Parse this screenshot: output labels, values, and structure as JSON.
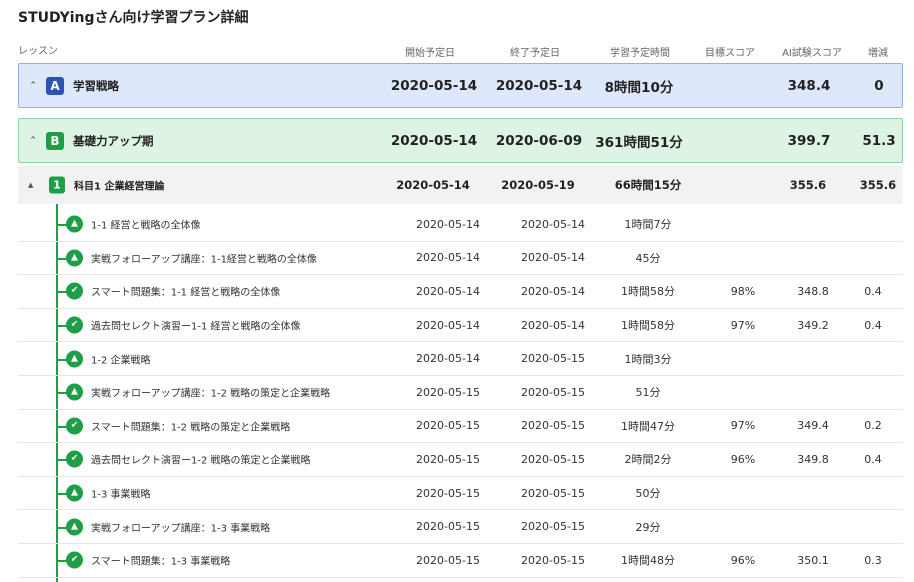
{
  "page": {
    "title": "STUDYingさん向け学習プラン詳細"
  },
  "header": {
    "lesson": "レッスン",
    "start": "開始予定日",
    "end": "終了予定日",
    "time": "学習予定時間",
    "target": "目標スコア",
    "ai_score": "AI試験スコア",
    "delta": "増減"
  },
  "phases": [
    {
      "badge": "A",
      "name": "学習戦略",
      "start": "2020-05-14",
      "end": "2020-05-14",
      "time": "8時間10分",
      "target": "",
      "ai_score": "348.4",
      "delta": "0",
      "expanded": true
    },
    {
      "badge": "B",
      "name": "基礎力アップ期",
      "start": "2020-05-14",
      "end": "2020-06-09",
      "time": "361時間51分",
      "target": "",
      "ai_score": "399.7",
      "delta": "51.3",
      "expanded": true
    }
  ],
  "subject": {
    "badge": "1",
    "name": "科目1 企業経営理論",
    "start": "2020-05-14",
    "end": "2020-05-19",
    "time": "66時間15分",
    "target": "",
    "ai_score": "355.6",
    "delta": "355.6"
  },
  "lessons": [
    {
      "icon": "graduation-cap-icon",
      "name": "1-1 経営と戦略の全体像",
      "start": "2020-05-14",
      "end": "2020-05-14",
      "time": "1時間7分",
      "target": "",
      "ai_score": "",
      "delta": ""
    },
    {
      "icon": "graduation-cap-icon",
      "name": "実戦フォローアップ講座：1-1経営と戦略の全体像",
      "start": "2020-05-14",
      "end": "2020-05-14",
      "time": "45分",
      "target": "",
      "ai_score": "",
      "delta": ""
    },
    {
      "icon": "checklist-icon",
      "name": "スマート問題集：1-1 経営と戦略の全体像",
      "start": "2020-05-14",
      "end": "2020-05-14",
      "time": "1時間58分",
      "target": "98%",
      "ai_score": "348.8",
      "delta": "0.4"
    },
    {
      "icon": "checklist-icon",
      "name": "過去問セレクト演習ー1-1 経営と戦略の全体像",
      "start": "2020-05-14",
      "end": "2020-05-14",
      "time": "1時間58分",
      "target": "97%",
      "ai_score": "349.2",
      "delta": "0.4"
    },
    {
      "icon": "graduation-cap-icon",
      "name": "1-2 企業戦略",
      "start": "2020-05-14",
      "end": "2020-05-15",
      "time": "1時間3分",
      "target": "",
      "ai_score": "",
      "delta": ""
    },
    {
      "icon": "graduation-cap-icon",
      "name": "実戦フォローアップ講座：1-2 戦略の策定と企業戦略",
      "start": "2020-05-15",
      "end": "2020-05-15",
      "time": "51分",
      "target": "",
      "ai_score": "",
      "delta": ""
    },
    {
      "icon": "checklist-icon",
      "name": "スマート問題集：1-2 戦略の策定と企業戦略",
      "start": "2020-05-15",
      "end": "2020-05-15",
      "time": "1時間47分",
      "target": "97%",
      "ai_score": "349.4",
      "delta": "0.2"
    },
    {
      "icon": "checklist-icon",
      "name": "過去問セレクト演習ー1-2 戦略の策定と企業戦略",
      "start": "2020-05-15",
      "end": "2020-05-15",
      "time": "2時間2分",
      "target": "96%",
      "ai_score": "349.8",
      "delta": "0.4"
    },
    {
      "icon": "graduation-cap-icon",
      "name": "1-3 事業戦略",
      "start": "2020-05-15",
      "end": "2020-05-15",
      "time": "50分",
      "target": "",
      "ai_score": "",
      "delta": ""
    },
    {
      "icon": "graduation-cap-icon",
      "name": "実戦フォローアップ講座：1-3 事業戦略",
      "start": "2020-05-15",
      "end": "2020-05-15",
      "time": "29分",
      "target": "",
      "ai_score": "",
      "delta": ""
    },
    {
      "icon": "checklist-icon",
      "name": "スマート問題集：1-3 事業戦略",
      "start": "2020-05-15",
      "end": "2020-05-15",
      "time": "1時間48分",
      "target": "96%",
      "ai_score": "350.1",
      "delta": "0.3"
    }
  ],
  "colors": {
    "phase_a": "#2c52b5",
    "phase_b": "#1f9e48",
    "tree": "#1f9e48"
  }
}
